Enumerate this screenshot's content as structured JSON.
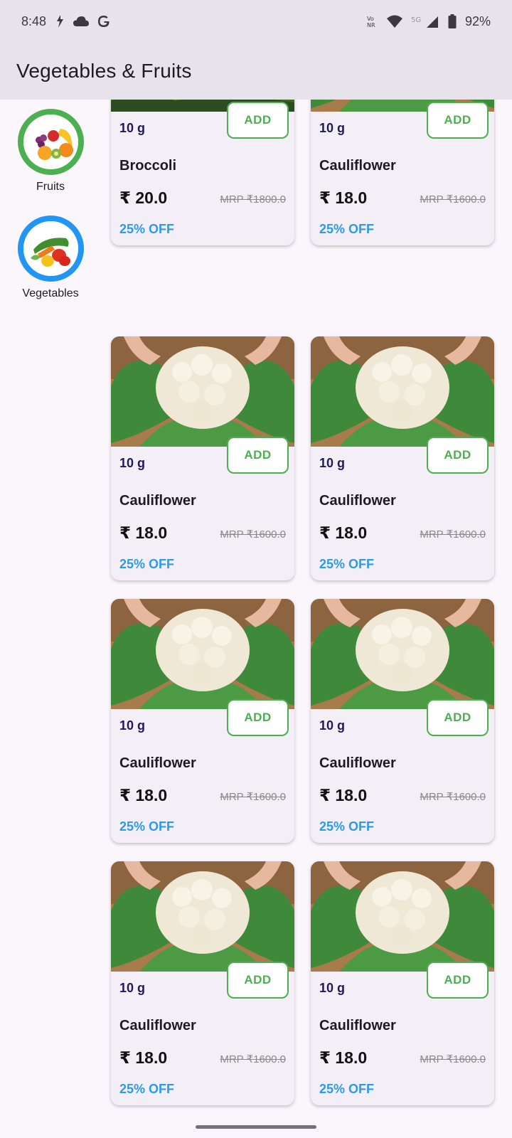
{
  "status_bar": {
    "time": "8:48",
    "battery": "92%",
    "network": "5G"
  },
  "app_bar": {
    "title": "Vegetables & Fruits"
  },
  "categories": [
    {
      "label": "Fruits",
      "ring_color": "#4caf50"
    },
    {
      "label": "Vegetables",
      "ring_color": "#2196f3"
    }
  ],
  "products": [
    {
      "name": "Broccoli",
      "weight": "10 g",
      "price": "₹ 20.0",
      "mrp": "MRP ₹1800.0",
      "discount": "25% OFF",
      "add_label": "ADD",
      "image": "broccoli"
    },
    {
      "name": "Cauliflower",
      "weight": "10 g",
      "price": "₹ 18.0",
      "mrp": "MRP ₹1600.0",
      "discount": "25% OFF",
      "add_label": "ADD",
      "image": "cauliflower"
    },
    {
      "name": "Cauliflower",
      "weight": "10 g",
      "price": "₹ 18.0",
      "mrp": "MRP ₹1600.0",
      "discount": "25% OFF",
      "add_label": "ADD",
      "image": "cauliflower"
    },
    {
      "name": "Cauliflower",
      "weight": "10 g",
      "price": "₹ 18.0",
      "mrp": "MRP ₹1600.0",
      "discount": "25% OFF",
      "add_label": "ADD",
      "image": "cauliflower"
    },
    {
      "name": "Cauliflower",
      "weight": "10 g",
      "price": "₹ 18.0",
      "mrp": "MRP ₹1600.0",
      "discount": "25% OFF",
      "add_label": "ADD",
      "image": "cauliflower"
    },
    {
      "name": "Cauliflower",
      "weight": "10 g",
      "price": "₹ 18.0",
      "mrp": "MRP ₹1600.0",
      "discount": "25% OFF",
      "add_label": "ADD",
      "image": "cauliflower"
    },
    {
      "name": "Cauliflower",
      "weight": "10 g",
      "price": "₹ 18.0",
      "mrp": "MRP ₹1600.0",
      "discount": "25% OFF",
      "add_label": "ADD",
      "image": "cauliflower"
    },
    {
      "name": "Cauliflower",
      "weight": "10 g",
      "price": "₹ 18.0",
      "mrp": "MRP ₹1600.0",
      "discount": "25% OFF",
      "add_label": "ADD",
      "image": "cauliflower"
    }
  ],
  "colors": {
    "accent_green": "#4caf50",
    "discount_blue": "#2b9be6",
    "weight_navy": "#1f1a5a",
    "app_bar_bg": "#e8e2ec"
  }
}
